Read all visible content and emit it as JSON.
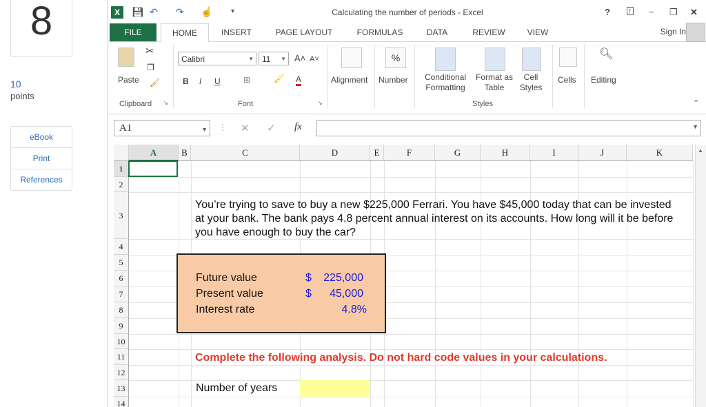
{
  "panel": {
    "question_number": "8",
    "points_value": "10",
    "points_label": "points",
    "buttons": [
      "eBook",
      "Print",
      "References"
    ]
  },
  "excel": {
    "window_title": "Calculating the number of periods - Excel",
    "title_controls": [
      "?",
      "−",
      "✕"
    ],
    "tabs": [
      "FILE",
      "HOME",
      "INSERT",
      "PAGE LAYOUT",
      "FORMULAS",
      "DATA",
      "REVIEW",
      "VIEW"
    ],
    "sign_in": "Sign In",
    "ribbon": {
      "clipboard_group": "Clipboard",
      "paste": "Paste",
      "font_group": "Font",
      "font_name": "Calibri",
      "font_size": "11",
      "bold": "B",
      "italic": "I",
      "underline": "U",
      "alignment": "Alignment",
      "number": "Number",
      "conditional_formatting_1": "Conditional",
      "conditional_formatting_2": "Formatting",
      "format_as_table_1": "Format as",
      "format_as_table_2": "Table",
      "cell_styles_1": "Cell",
      "cell_styles_2": "Styles",
      "styles_group": "Styles",
      "cells": "Cells",
      "editing": "Editing"
    },
    "name_box": "A1",
    "fx": "fx",
    "columns": [
      "A",
      "B",
      "C",
      "D",
      "E",
      "F",
      "G",
      "H",
      "I",
      "J",
      "K"
    ],
    "rows": [
      "1",
      "2",
      "3",
      "4",
      "5",
      "6",
      "7",
      "8",
      "9",
      "10",
      "11",
      "12",
      "13",
      "14"
    ],
    "question": "You’re trying to save to buy a new $225,000 Ferrari. You have $45,000 today that can be invested at your bank. The bank pays 4.8 percent annual interest on its accounts. How long will it be before you have enough to buy the car?",
    "inputs": [
      {
        "label": "Future value",
        "currency": "$",
        "value": "225,000"
      },
      {
        "label": "Present value",
        "currency": "$",
        "value": "45,000"
      },
      {
        "label": "Interest rate",
        "currency": "",
        "value": "4.8%"
      }
    ],
    "instruction": "Complete the following analysis. Do not hard code values in your calculations.",
    "output_label": "Number of years"
  }
}
